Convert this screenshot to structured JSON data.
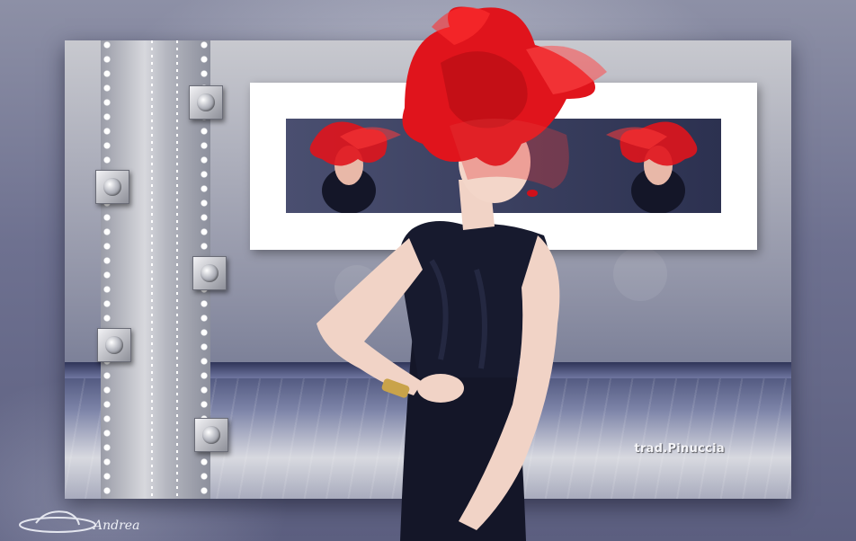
{
  "scene": {
    "description_colors": {
      "background": "#6e7190",
      "accent_red": "#e0141c",
      "dress": "#141628",
      "panel_white": "#ffffff"
    }
  },
  "watermark": {
    "text": "trad.Pinuccia"
  },
  "signature": {
    "text": "Andrea"
  }
}
